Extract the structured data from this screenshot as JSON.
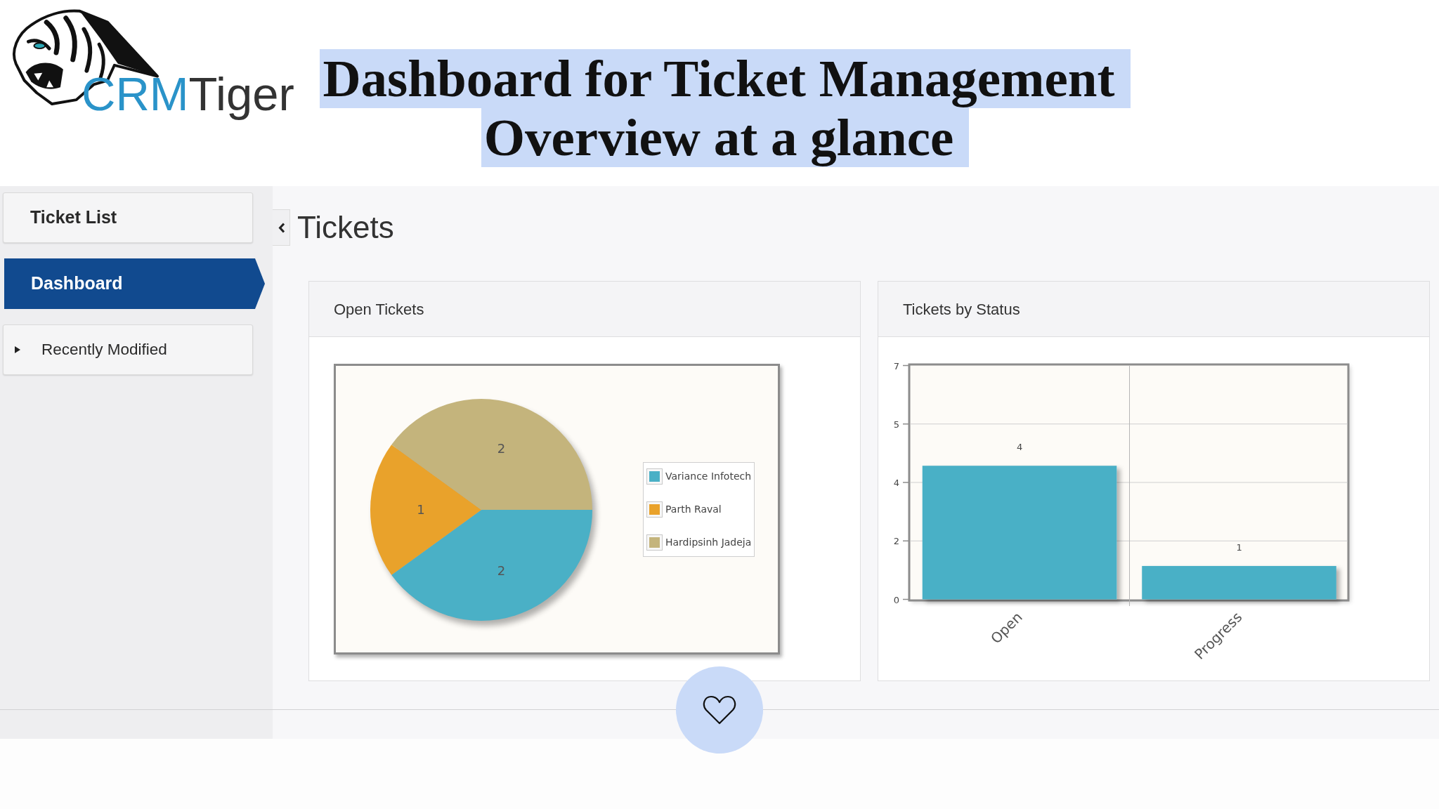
{
  "logo": {
    "parts": [
      {
        "text": "CRM",
        "color": "#2a93c9"
      },
      {
        "text": "Tiger",
        "color": "#333333"
      }
    ]
  },
  "headline": {
    "lines": [
      "Dashboard for Ticket Management",
      "Overview at a glance"
    ]
  },
  "sidebar": {
    "items": [
      {
        "kind": "link",
        "label": "Ticket List",
        "selected": false
      },
      {
        "kind": "link",
        "label": "Dashboard",
        "selected": true
      },
      {
        "kind": "expander",
        "label": "Recently Modified",
        "selected": false,
        "expanded": false
      }
    ]
  },
  "page": {
    "title": "Tickets"
  },
  "panels": [
    {
      "title": "Open Tickets",
      "chart_data": {
        "type": "pie",
        "categories": [
          "Variance Infotech",
          "Parth Raval",
          "Hardipsinh Jadeja"
        ],
        "values": [
          2,
          1,
          2
        ],
        "colors": [
          "#4ab0c6",
          "#e9a22b",
          "#c4b47c"
        ],
        "data_labels": true,
        "legend": "right"
      }
    },
    {
      "title": "Tickets by Status",
      "chart_data": {
        "type": "bar",
        "categories": [
          "Open",
          "Progress"
        ],
        "values": [
          4,
          1
        ],
        "color": "#4ab0c6",
        "ylim": [
          0,
          7
        ],
        "yticks": [
          {
            "value": 0,
            "label": "0"
          },
          {
            "value": 1.75,
            "label": "2"
          },
          {
            "value": 3.5,
            "label": "4"
          },
          {
            "value": 5.25,
            "label": "5"
          },
          {
            "value": 7,
            "label": "7"
          }
        ],
        "data_labels": true,
        "grid": true
      }
    }
  ]
}
